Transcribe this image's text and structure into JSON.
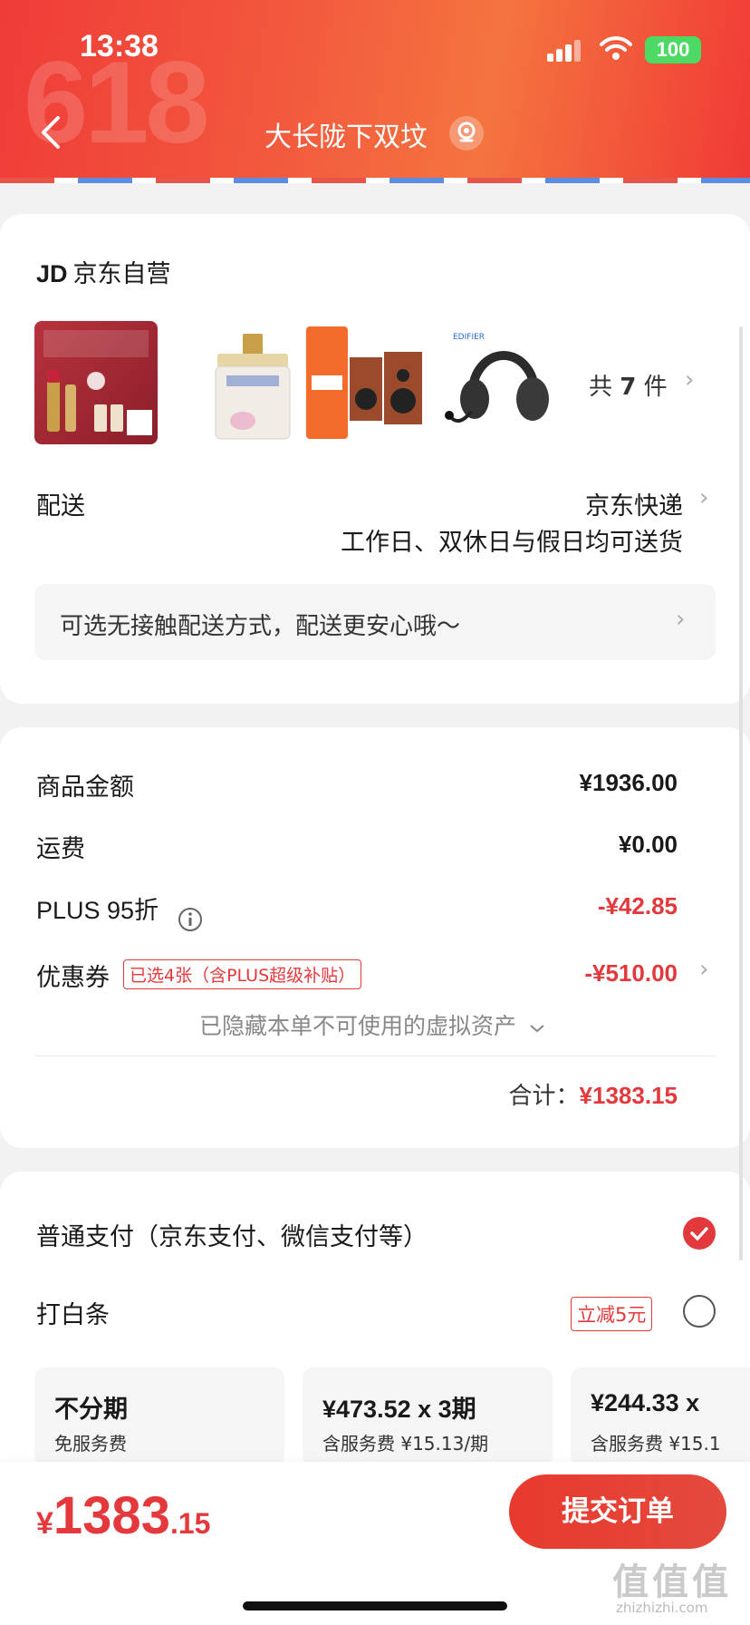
{
  "status_bar": {
    "time": "13:38",
    "battery": "100"
  },
  "header": {
    "bg_text": "618",
    "title": "大长陇下双坟"
  },
  "order": {
    "store_logo": "JD",
    "store_name": "京东自营",
    "item_count_prefix": "共",
    "item_count": "7",
    "item_count_suffix": "件",
    "products": [
      {
        "name": "lipstick-set"
      },
      {
        "name": "essence-bottle"
      },
      {
        "name": "bookshelf-speakers"
      },
      {
        "name": "headset"
      }
    ],
    "delivery_label": "配送",
    "delivery_method": "京东快递",
    "delivery_time": "工作日、双休日与假日均可送货",
    "contactless_notice": "可选无接触配送方式，配送更安心哦～"
  },
  "summary": {
    "goods_label": "商品金额",
    "goods_value": "¥1936.00",
    "shipping_label": "运费",
    "shipping_value": "¥0.00",
    "plus_label": "PLUS 95折",
    "plus_value": "-¥42.85",
    "coupon_label": "优惠券",
    "coupon_tag": "已选4张（含PLUS超级补贴）",
    "coupon_value": "-¥510.00",
    "hidden_note": "已隐藏本单不可使用的虚拟资产",
    "total_label": "合计：",
    "total_value": "¥1383.15"
  },
  "payment": {
    "normal_label": "普通支付（京东支付、微信支付等）",
    "baitiao_label": "打白条",
    "baitiao_tag": "立减5元",
    "plans": [
      {
        "title": "不分期",
        "sub": "免服务费"
      },
      {
        "title": "¥473.52 x 3期",
        "sub": "含服务费 ¥15.13/期"
      },
      {
        "title": "¥244.33 x",
        "sub": "含服务费 ¥15.1"
      }
    ]
  },
  "bottom_bar": {
    "currency": "¥",
    "price_int": "1383",
    "price_dec": ".15",
    "submit_label": "提交订单"
  },
  "watermark": {
    "text": "值值值",
    "sub": "zhizhizhi.com"
  },
  "colors": {
    "accent": "#e4393c",
    "header": "#f2563d",
    "battery": "#4cd964"
  }
}
